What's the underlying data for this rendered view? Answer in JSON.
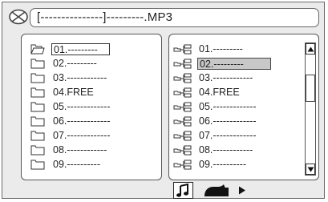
{
  "path": {
    "text": "[---------------]---------.MP3"
  },
  "left_panel": {
    "items": [
      {
        "label": "01.---------",
        "selected": true,
        "icon": "folder-open-icon"
      },
      {
        "label": "02.---------",
        "icon": "folder-icon"
      },
      {
        "label": "03.------------",
        "icon": "folder-icon"
      },
      {
        "label": "04.FREE",
        "icon": "folder-icon"
      },
      {
        "label": "05.-------------",
        "icon": "folder-icon"
      },
      {
        "label": "06.-------------",
        "icon": "folder-icon"
      },
      {
        "label": "07.-------------",
        "icon": "folder-icon"
      },
      {
        "label": "08.------------",
        "icon": "folder-icon"
      },
      {
        "label": "09.----------",
        "icon": "folder-icon"
      }
    ]
  },
  "right_panel": {
    "items": [
      {
        "label": "01.---------",
        "icon": "folder-tree-icon"
      },
      {
        "label": "02.---------",
        "selected": true,
        "icon": "folder-tree-icon"
      },
      {
        "label": "03.------------",
        "icon": "folder-tree-icon"
      },
      {
        "label": "04.FREE",
        "icon": "folder-tree-icon"
      },
      {
        "label": "05.-------------",
        "icon": "folder-tree-icon"
      },
      {
        "label": "06.-------------",
        "icon": "folder-tree-icon"
      },
      {
        "label": "07.-------------",
        "icon": "folder-tree-icon"
      },
      {
        "label": "08.------------",
        "icon": "folder-tree-icon"
      },
      {
        "label": "09.----------",
        "icon": "folder-tree-icon"
      }
    ]
  },
  "bottom_bar": {
    "icons": [
      "music-note-icon",
      "photo-icon",
      "play-icon"
    ]
  },
  "colors": {
    "background": "#ebebeb",
    "panel": "#ffffff",
    "selected_highlight": "#c8c8c8",
    "border": "#555555"
  }
}
